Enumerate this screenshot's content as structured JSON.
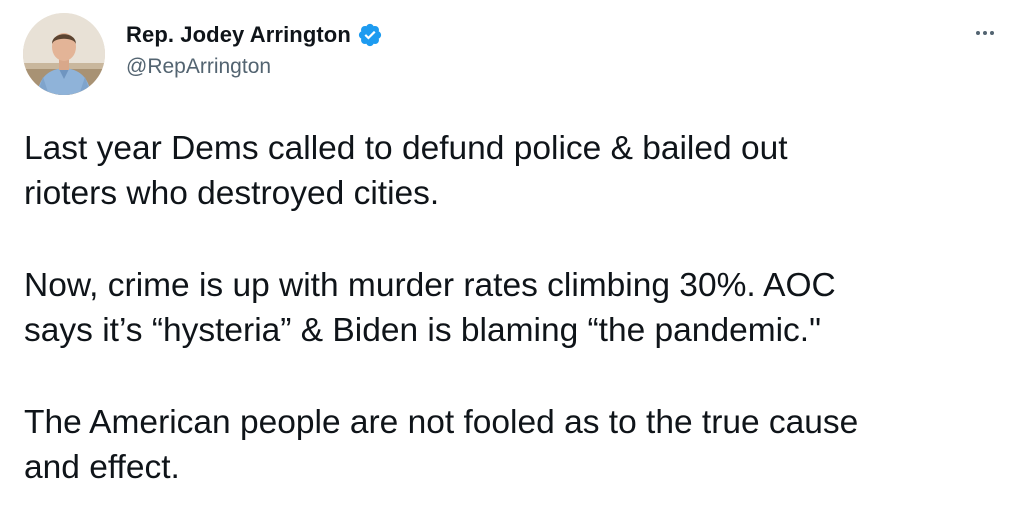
{
  "author": {
    "display_name": "Rep. Jodey Arrington",
    "handle": "@RepArrington",
    "verified": true,
    "verified_icon": "verified-badge-icon",
    "avatar_icon": "profile-avatar"
  },
  "more_icon": "more-options-icon",
  "tweet": {
    "paragraphs": [
      "Last year Dems called to defund police & bailed out\nrioters who destroyed cities.",
      "Now, crime is up with murder rates climbing 30%. AOC\nsays it’s “hysteria” & Biden is blaming “the pandemic.\"",
      "The American people are not fooled as to the true cause\nand effect."
    ]
  },
  "colors": {
    "text": "#0f1419",
    "secondary": "#536471",
    "verified": "#1d9bf0"
  }
}
